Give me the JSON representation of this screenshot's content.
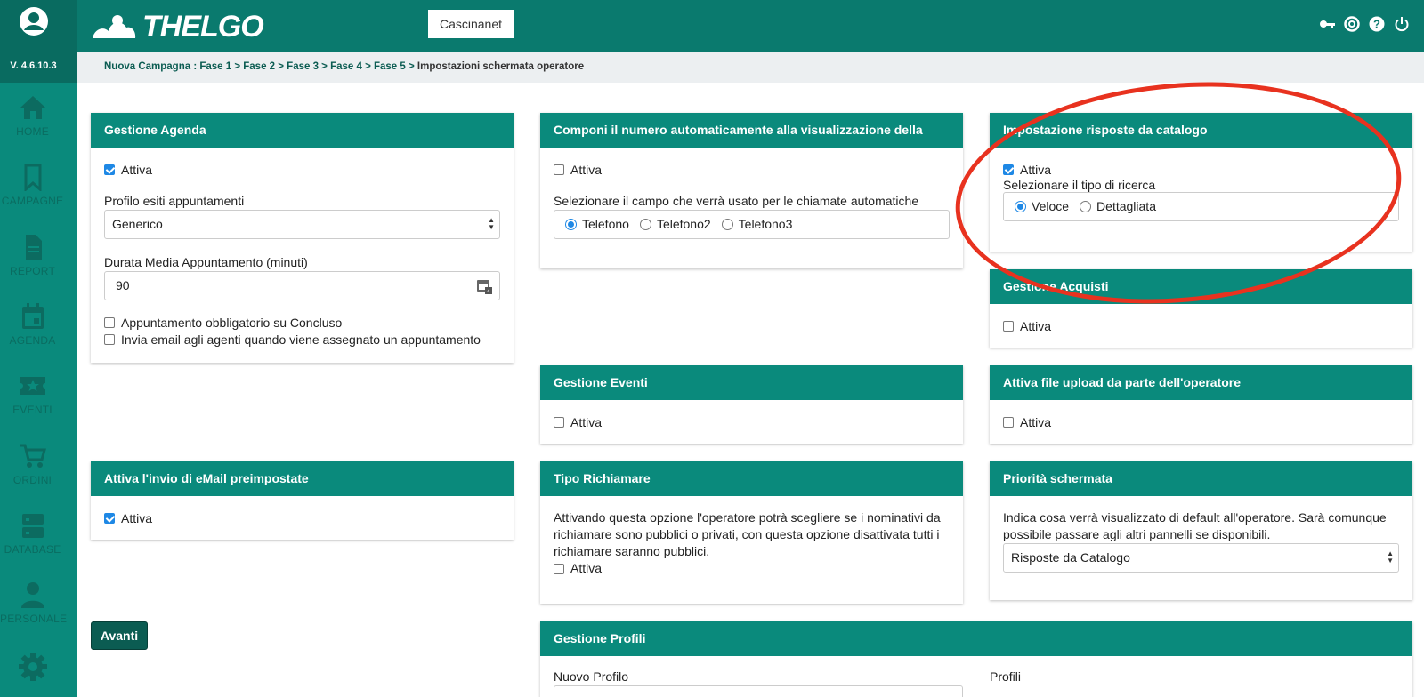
{
  "app": {
    "logo_text": "THELGO",
    "version": "V. 4.6.10.3",
    "tenant": "Cascinanet"
  },
  "sidebar": {
    "items": [
      {
        "label": "HOME",
        "icon": "home-icon"
      },
      {
        "label": "CAMPAGNE",
        "icon": "bookmark-icon"
      },
      {
        "label": "REPORT",
        "icon": "document-icon"
      },
      {
        "label": "AGENDA",
        "icon": "calendar-icon"
      },
      {
        "label": "EVENTI",
        "icon": "ticket-star-icon"
      },
      {
        "label": "ORDINI",
        "icon": "cart-icon"
      },
      {
        "label": "DATABASE",
        "icon": "database-icon"
      },
      {
        "label": "PERSONALE",
        "icon": "person-icon"
      },
      {
        "label": "",
        "icon": "gear-icon"
      }
    ]
  },
  "breadcrumb": {
    "path": "Nuova Campagna : Fase 1 > Fase 2 > Fase 3 > Fase 4 > Fase 5 > ",
    "current": "Impostazioni schermata operatore"
  },
  "cards": {
    "agenda": {
      "title": "Gestione Agenda",
      "active_label": "Attiva",
      "active_checked": true,
      "profile_label": "Profilo esiti appuntamenti",
      "profile_value": "Generico",
      "duration_label": "Durata Media Appuntamento (minuti)",
      "duration_value": "90",
      "opt1": "Appuntamento obbligatorio su Concluso",
      "opt2": "Invia email agli agenti quando viene assegnato un appuntamento"
    },
    "autodial": {
      "title": "Componi il numero automaticamente alla visualizzazione della scheda",
      "active_label": "Attiva",
      "field_label": "Selezionare il campo che verrà usato per le chiamate automatiche",
      "options": [
        "Telefono",
        "Telefono2",
        "Telefono3"
      ],
      "selected": "Telefono"
    },
    "catalog": {
      "title": "Impostazione risposte da catalogo",
      "active_label": "Attiva",
      "search_label": "Selezionare il tipo di ricerca",
      "options": [
        "Veloce",
        "Dettagliata"
      ],
      "selected": "Veloce"
    },
    "purchases": {
      "title": "Gestione Acquisti",
      "active_label": "Attiva"
    },
    "events": {
      "title": "Gestione Eventi",
      "active_label": "Attiva"
    },
    "upload": {
      "title": "Attiva file upload da parte dell'operatore",
      "active_label": "Attiva"
    },
    "email": {
      "title": "Attiva l'invio di eMail preimpostate",
      "active_label": "Attiva"
    },
    "recall": {
      "title": "Tipo Richiamare",
      "description": "Attivando questa opzione l'operatore potrà scegliere se i nominativi da richiamare sono pubblici o privati, con questa opzione disattivata tutti i richiamare saranno pubblici.",
      "active_label": "Attiva"
    },
    "priority": {
      "title": "Priorità schermata",
      "description": "Indica cosa verrà visualizzato di default all'operatore. Sarà comunque possibile passare agli altri pannelli se disponibili.",
      "select_value": "Risposte da Catalogo"
    },
    "profiles": {
      "title": "Gestione Profili",
      "new_profile_label": "Nuovo Profilo",
      "profiles_label": "Profili"
    }
  },
  "actions": {
    "next_label": "Avanti"
  },
  "colors": {
    "primary": "#0a8a7c",
    "topbar": "#0a7a6e",
    "button": "#0b5c52",
    "annotation": "#e8321f",
    "checkbox": "#1e88e5"
  }
}
